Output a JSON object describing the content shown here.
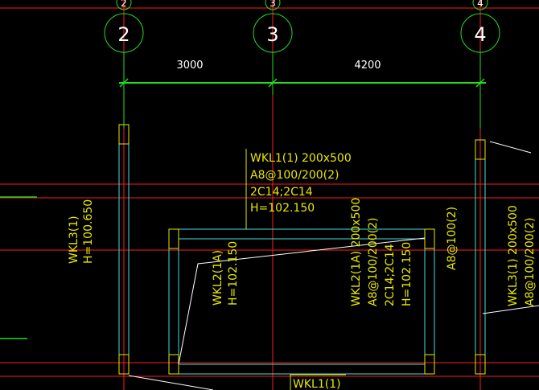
{
  "colors": {
    "background": "#000000",
    "grid_line": "#ff1a1a",
    "axis_bubble": "#22dd22",
    "dimension": "#22dd22",
    "beam_outline": "#40e0e0",
    "annotation": "#e8e800",
    "leader": "#ffffff"
  },
  "axes": [
    {
      "id": "2",
      "top_label": "2",
      "label": "2"
    },
    {
      "id": "3",
      "top_label": "3",
      "label": "3"
    },
    {
      "id": "4",
      "top_label": "4",
      "label": "4"
    }
  ],
  "dimensions": [
    {
      "span": "2-3",
      "value": "3000"
    },
    {
      "span": "3-4",
      "value": "4200"
    }
  ],
  "annotations": {
    "wkl1_top": [
      "WKL1(1) 200x500",
      "A8@100/200(2)",
      "2C14;2C14",
      "H=102.150"
    ],
    "wkl3_left": [
      "WKL3(1)",
      "H=100.650"
    ],
    "wkl2_inner": [
      "WKL2(1A)",
      "H=102.150"
    ],
    "wkl2_right": [
      "WKL2(1A) 200x500",
      "A8@100/200(2)",
      "2C14;2C14",
      "H=102.150"
    ],
    "a8_stirrup": [
      "A8@100(2)"
    ],
    "wkl3_right": [
      "WKL3(1) 200x500",
      "A8@100/200(2)"
    ],
    "wkl1_bottom": [
      "WKL1(1)"
    ]
  }
}
